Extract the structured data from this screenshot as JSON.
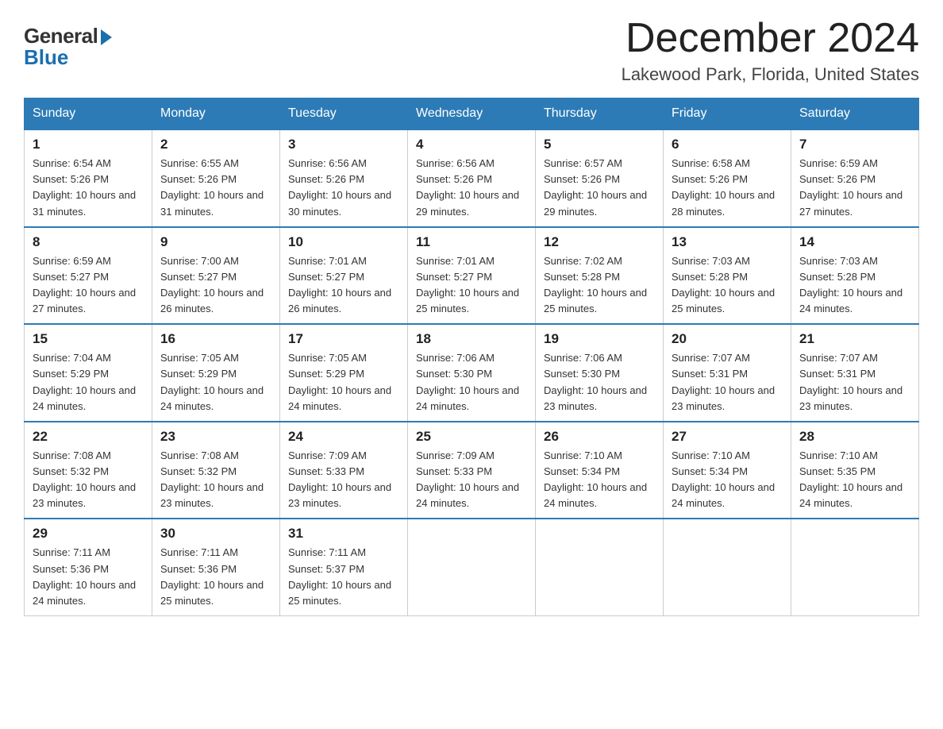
{
  "header": {
    "logo_general": "General",
    "logo_blue": "Blue",
    "month_title": "December 2024",
    "location": "Lakewood Park, Florida, United States"
  },
  "days_of_week": [
    "Sunday",
    "Monday",
    "Tuesday",
    "Wednesday",
    "Thursday",
    "Friday",
    "Saturday"
  ],
  "weeks": [
    [
      {
        "day": "1",
        "sunrise": "6:54 AM",
        "sunset": "5:26 PM",
        "daylight": "10 hours and 31 minutes."
      },
      {
        "day": "2",
        "sunrise": "6:55 AM",
        "sunset": "5:26 PM",
        "daylight": "10 hours and 31 minutes."
      },
      {
        "day": "3",
        "sunrise": "6:56 AM",
        "sunset": "5:26 PM",
        "daylight": "10 hours and 30 minutes."
      },
      {
        "day": "4",
        "sunrise": "6:56 AM",
        "sunset": "5:26 PM",
        "daylight": "10 hours and 29 minutes."
      },
      {
        "day": "5",
        "sunrise": "6:57 AM",
        "sunset": "5:26 PM",
        "daylight": "10 hours and 29 minutes."
      },
      {
        "day": "6",
        "sunrise": "6:58 AM",
        "sunset": "5:26 PM",
        "daylight": "10 hours and 28 minutes."
      },
      {
        "day": "7",
        "sunrise": "6:59 AM",
        "sunset": "5:26 PM",
        "daylight": "10 hours and 27 minutes."
      }
    ],
    [
      {
        "day": "8",
        "sunrise": "6:59 AM",
        "sunset": "5:27 PM",
        "daylight": "10 hours and 27 minutes."
      },
      {
        "day": "9",
        "sunrise": "7:00 AM",
        "sunset": "5:27 PM",
        "daylight": "10 hours and 26 minutes."
      },
      {
        "day": "10",
        "sunrise": "7:01 AM",
        "sunset": "5:27 PM",
        "daylight": "10 hours and 26 minutes."
      },
      {
        "day": "11",
        "sunrise": "7:01 AM",
        "sunset": "5:27 PM",
        "daylight": "10 hours and 25 minutes."
      },
      {
        "day": "12",
        "sunrise": "7:02 AM",
        "sunset": "5:28 PM",
        "daylight": "10 hours and 25 minutes."
      },
      {
        "day": "13",
        "sunrise": "7:03 AM",
        "sunset": "5:28 PM",
        "daylight": "10 hours and 25 minutes."
      },
      {
        "day": "14",
        "sunrise": "7:03 AM",
        "sunset": "5:28 PM",
        "daylight": "10 hours and 24 minutes."
      }
    ],
    [
      {
        "day": "15",
        "sunrise": "7:04 AM",
        "sunset": "5:29 PM",
        "daylight": "10 hours and 24 minutes."
      },
      {
        "day": "16",
        "sunrise": "7:05 AM",
        "sunset": "5:29 PM",
        "daylight": "10 hours and 24 minutes."
      },
      {
        "day": "17",
        "sunrise": "7:05 AM",
        "sunset": "5:29 PM",
        "daylight": "10 hours and 24 minutes."
      },
      {
        "day": "18",
        "sunrise": "7:06 AM",
        "sunset": "5:30 PM",
        "daylight": "10 hours and 24 minutes."
      },
      {
        "day": "19",
        "sunrise": "7:06 AM",
        "sunset": "5:30 PM",
        "daylight": "10 hours and 23 minutes."
      },
      {
        "day": "20",
        "sunrise": "7:07 AM",
        "sunset": "5:31 PM",
        "daylight": "10 hours and 23 minutes."
      },
      {
        "day": "21",
        "sunrise": "7:07 AM",
        "sunset": "5:31 PM",
        "daylight": "10 hours and 23 minutes."
      }
    ],
    [
      {
        "day": "22",
        "sunrise": "7:08 AM",
        "sunset": "5:32 PM",
        "daylight": "10 hours and 23 minutes."
      },
      {
        "day": "23",
        "sunrise": "7:08 AM",
        "sunset": "5:32 PM",
        "daylight": "10 hours and 23 minutes."
      },
      {
        "day": "24",
        "sunrise": "7:09 AM",
        "sunset": "5:33 PM",
        "daylight": "10 hours and 23 minutes."
      },
      {
        "day": "25",
        "sunrise": "7:09 AM",
        "sunset": "5:33 PM",
        "daylight": "10 hours and 24 minutes."
      },
      {
        "day": "26",
        "sunrise": "7:10 AM",
        "sunset": "5:34 PM",
        "daylight": "10 hours and 24 minutes."
      },
      {
        "day": "27",
        "sunrise": "7:10 AM",
        "sunset": "5:34 PM",
        "daylight": "10 hours and 24 minutes."
      },
      {
        "day": "28",
        "sunrise": "7:10 AM",
        "sunset": "5:35 PM",
        "daylight": "10 hours and 24 minutes."
      }
    ],
    [
      {
        "day": "29",
        "sunrise": "7:11 AM",
        "sunset": "5:36 PM",
        "daylight": "10 hours and 24 minutes."
      },
      {
        "day": "30",
        "sunrise": "7:11 AM",
        "sunset": "5:36 PM",
        "daylight": "10 hours and 25 minutes."
      },
      {
        "day": "31",
        "sunrise": "7:11 AM",
        "sunset": "5:37 PM",
        "daylight": "10 hours and 25 minutes."
      },
      null,
      null,
      null,
      null
    ]
  ],
  "labels": {
    "sunrise": "Sunrise: ",
    "sunset": "Sunset: ",
    "daylight": "Daylight: "
  }
}
